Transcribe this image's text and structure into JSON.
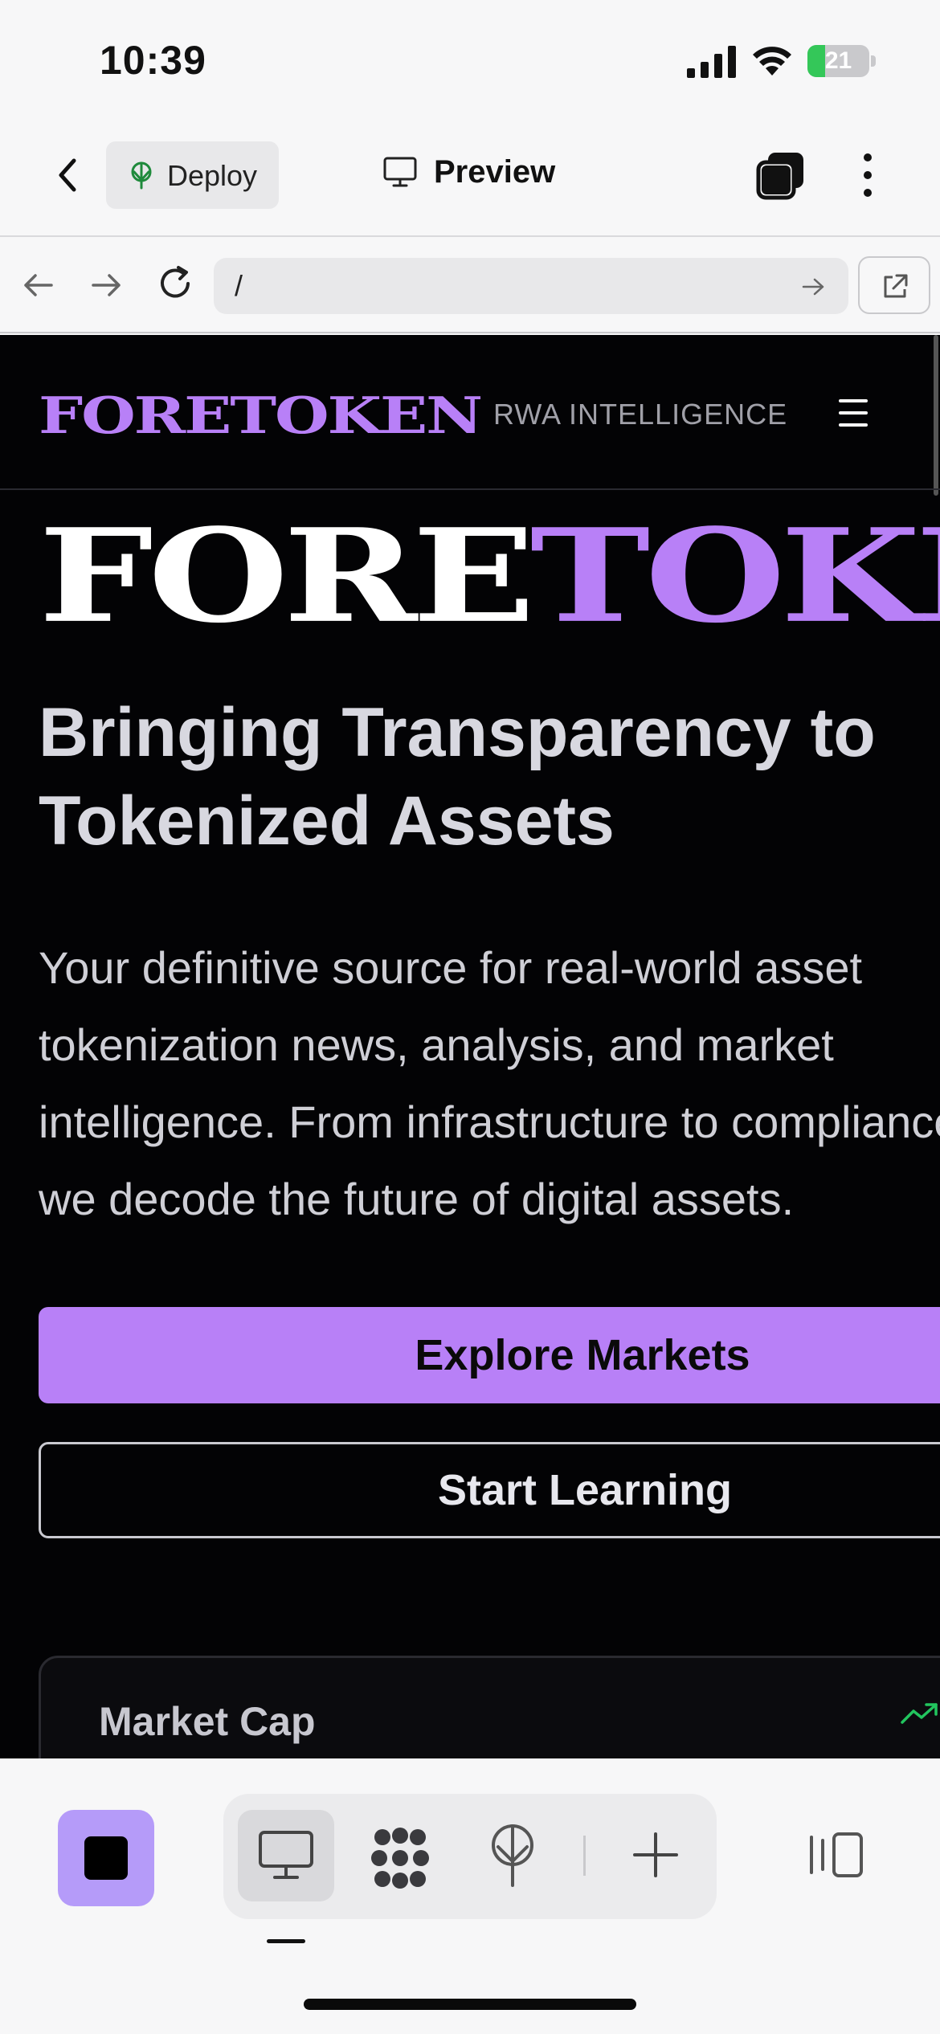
{
  "status_bar": {
    "time": "10:39",
    "battery_percent": "21"
  },
  "app_bar": {
    "deploy_label": "Deploy",
    "preview_label": "Preview"
  },
  "browser": {
    "url": "/"
  },
  "site": {
    "logo": "FORETOKEN",
    "tagline": "RWA INTELLIGENCE",
    "hero_brand_part1": "FORE",
    "hero_brand_part2": "TOKEN",
    "heading": "Bringing Transparency to Tokenized Assets",
    "body": "Your definitive source for real-world asset tokenization news, analysis, and market intelligence. From infrastructure to compliance, we decode the future of digital assets.",
    "primary_button": "Explore Markets",
    "secondary_button": "Start Learning",
    "stat_card_label": "Market Cap",
    "accent_color": "#b880f7",
    "trend_color": "#22c55e"
  },
  "toolbar": {
    "stop_color": "#b59bf9",
    "icons": [
      "preview-icon",
      "apps-icon",
      "deploy-icon",
      "add-icon",
      "panel-icon"
    ]
  }
}
